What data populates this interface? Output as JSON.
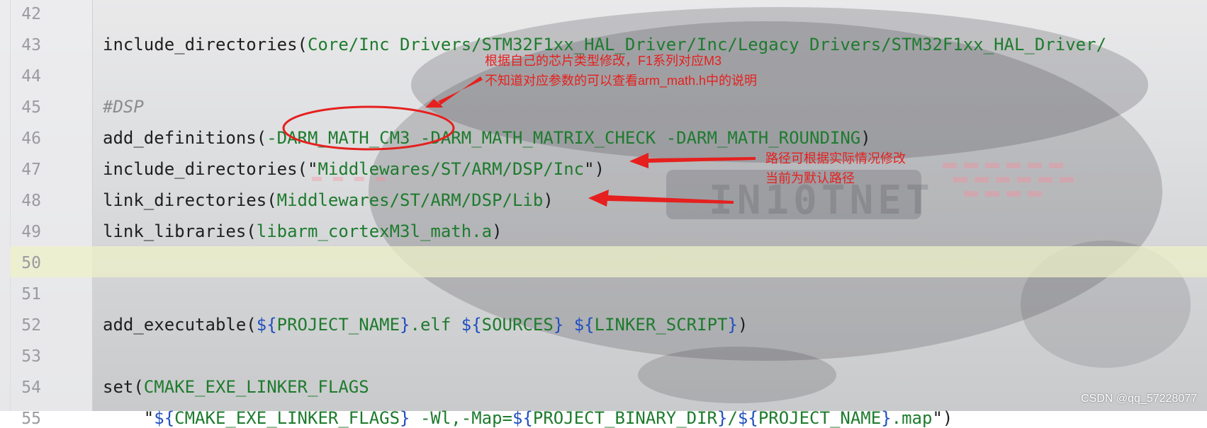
{
  "editor": {
    "lines": [
      {
        "num": "42",
        "parts": []
      },
      {
        "num": "43",
        "parts": [
          {
            "t": "include_directories(",
            "c": ""
          },
          {
            "t": "Core/Inc Drivers/STM32F1xx_HAL_Driver/Inc/Legacy Drivers/STM32F1xx_HAL_Driver/",
            "c": "g"
          }
        ]
      },
      {
        "num": "44",
        "parts": []
      },
      {
        "num": "45",
        "parts": [
          {
            "t": "#DSP",
            "c": "c"
          }
        ]
      },
      {
        "num": "46",
        "parts": [
          {
            "t": "add_definitions(",
            "c": ""
          },
          {
            "t": "-DARM_MATH_CM3 -DARM_MATH_MATRIX_CHECK -DARM_MATH_ROUNDING",
            "c": "g"
          },
          {
            "t": ")",
            "c": ""
          }
        ]
      },
      {
        "num": "47",
        "parts": [
          {
            "t": "include_directories(\"",
            "c": ""
          },
          {
            "t": "Middlewares/ST/ARM/DSP/Inc",
            "c": "g"
          },
          {
            "t": "\")",
            "c": ""
          }
        ]
      },
      {
        "num": "48",
        "parts": [
          {
            "t": "link_directories(",
            "c": ""
          },
          {
            "t": "Middlewares/ST/ARM/DSP/Lib",
            "c": "g"
          },
          {
            "t": ")",
            "c": ""
          }
        ]
      },
      {
        "num": "49",
        "parts": [
          {
            "t": "link_libraries(",
            "c": ""
          },
          {
            "t": "libarm_cortexM3l_math.a",
            "c": "g"
          },
          {
            "t": ")",
            "c": ""
          }
        ]
      },
      {
        "num": "50",
        "parts": [],
        "current": true
      },
      {
        "num": "51",
        "parts": []
      },
      {
        "num": "52",
        "parts": [
          {
            "t": "add_executable(",
            "c": ""
          },
          {
            "t": "${",
            "c": "b"
          },
          {
            "t": "PROJECT_NAME",
            "c": "g"
          },
          {
            "t": "}",
            "c": "b"
          },
          {
            "t": ".elf ",
            "c": "g"
          },
          {
            "t": "${",
            "c": "b"
          },
          {
            "t": "SOURCES",
            "c": "g"
          },
          {
            "t": "}",
            "c": "b"
          },
          {
            "t": " ",
            "c": ""
          },
          {
            "t": "${",
            "c": "b"
          },
          {
            "t": "LINKER_SCRIPT",
            "c": "g"
          },
          {
            "t": "}",
            "c": "b"
          },
          {
            "t": ")",
            "c": ""
          }
        ]
      },
      {
        "num": "53",
        "parts": []
      },
      {
        "num": "54",
        "parts": [
          {
            "t": "set(",
            "c": ""
          },
          {
            "t": "CMAKE_EXE_LINKER_FLAGS",
            "c": "g"
          }
        ]
      },
      {
        "num": "55",
        "parts": [
          {
            "t": "    \"",
            "c": ""
          },
          {
            "t": "${",
            "c": "b"
          },
          {
            "t": "CMAKE_EXE_LINKER_FLAGS",
            "c": "g"
          },
          {
            "t": "}",
            "c": "b"
          },
          {
            "t": " -Wl,-Map=",
            "c": "g"
          },
          {
            "t": "${",
            "c": "b"
          },
          {
            "t": "PROJECT_BINARY_DIR",
            "c": "g"
          },
          {
            "t": "}",
            "c": "b"
          },
          {
            "t": "/",
            "c": "g"
          },
          {
            "t": "${",
            "c": "b"
          },
          {
            "t": "PROJECT_NAME",
            "c": "g"
          },
          {
            "t": "}",
            "c": "b"
          },
          {
            "t": ".map",
            "c": "g"
          },
          {
            "t": "\")",
            "c": ""
          }
        ]
      }
    ]
  },
  "annotations": {
    "note1_line1": "根据自己的芯片类型修改，F1系列对应M3",
    "note1_line2": "不知道对应参数的可以查看arm_math.h中的说明",
    "note2_line1": "路径可根据实际情况修改",
    "note2_line2": "当前为默认路径"
  },
  "watermark": "CSDN @qq_57228077",
  "colors": {
    "string_green": "#1e7b2e",
    "variable_blue": "#1f4fbf",
    "comment_gray": "#8c8c8c",
    "annotation_red": "#e5201e",
    "current_line": "#eef0c8"
  }
}
